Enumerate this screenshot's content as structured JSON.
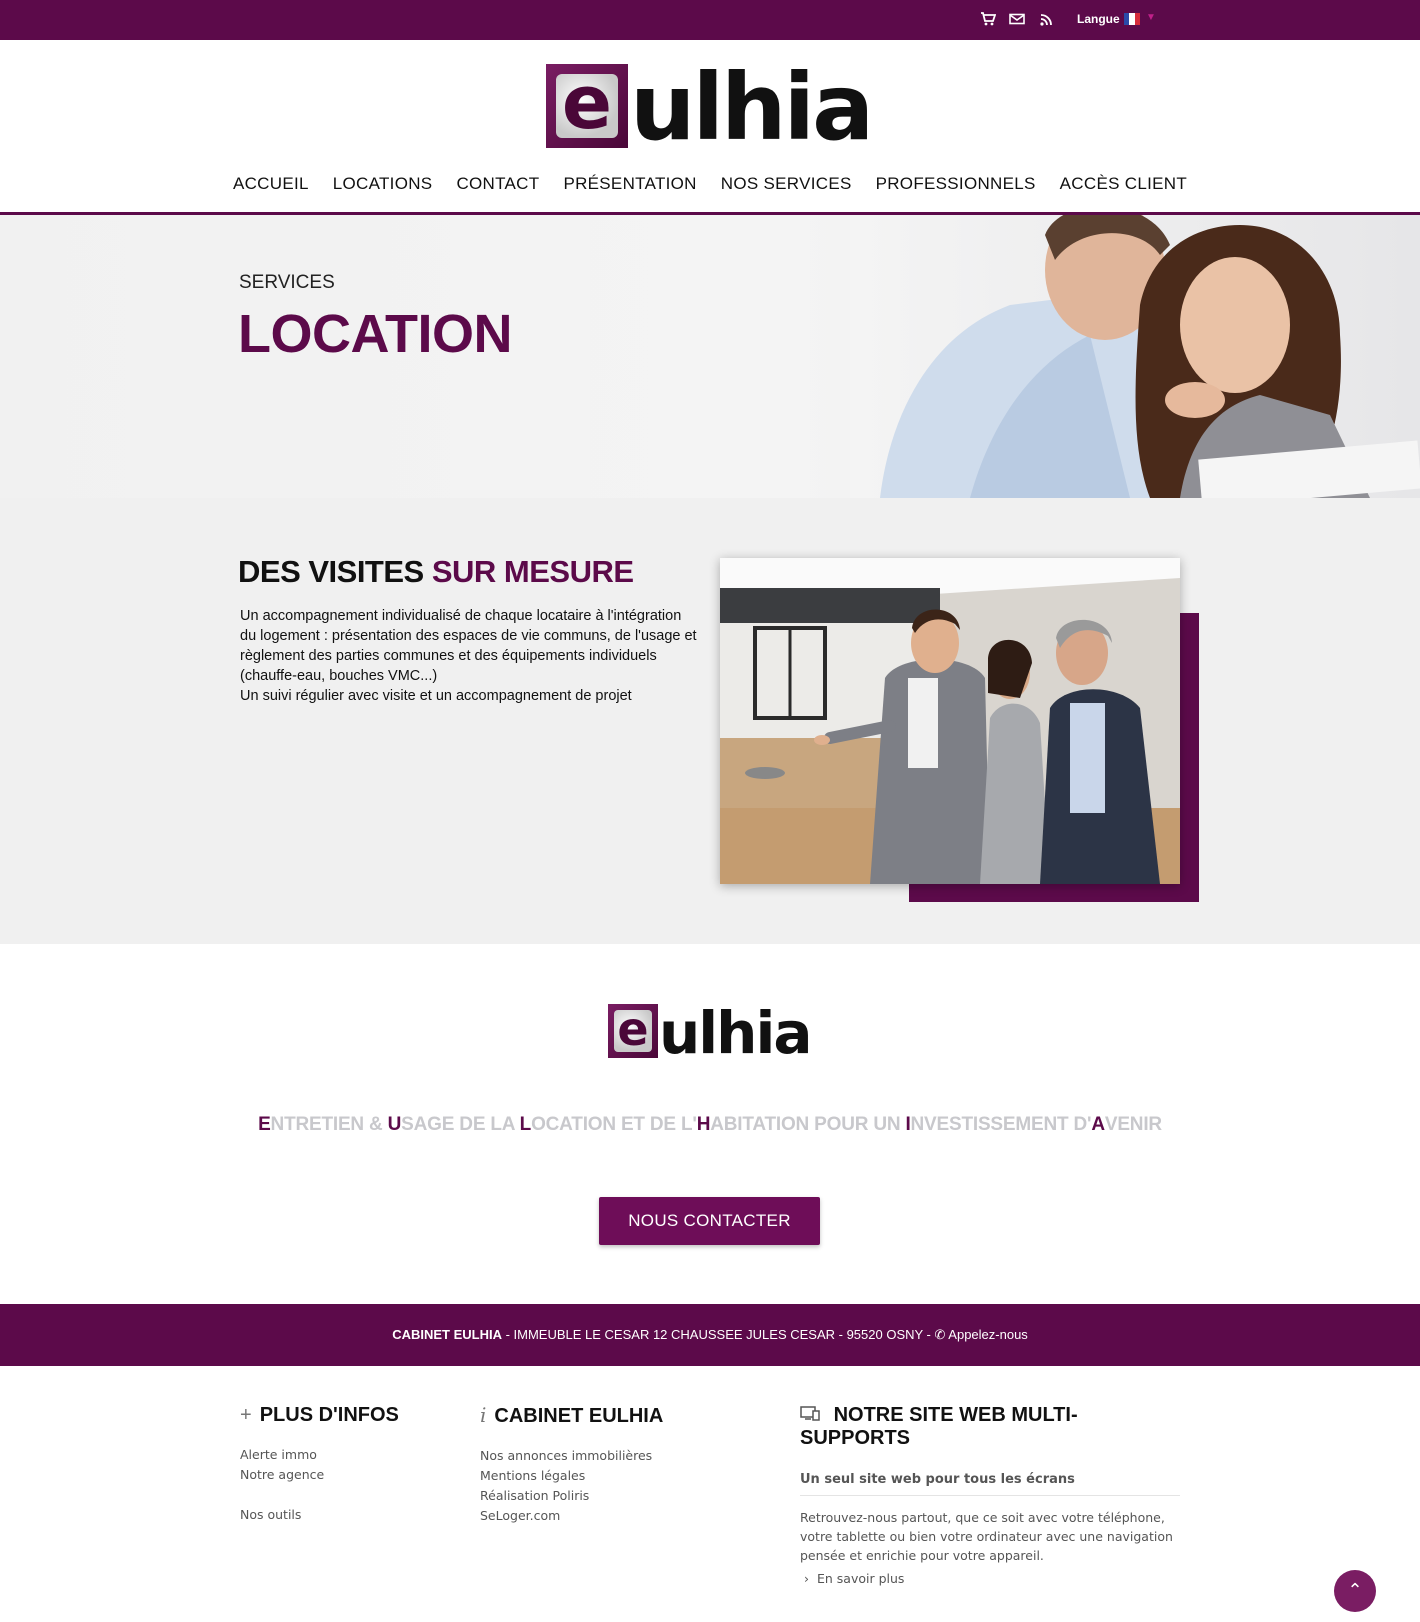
{
  "topbar": {
    "lang_label": "Langue",
    "icons": [
      "cart-icon",
      "mail-icon",
      "rss-icon"
    ]
  },
  "logo": {
    "mark": "e",
    "rest": "ulhia"
  },
  "nav": [
    "ACCUEIL",
    "LOCATIONS",
    "CONTACT",
    "PRÉSENTATION",
    "NOS SERVICES",
    "PROFESSIONNELS",
    "ACCÈS CLIENT"
  ],
  "hero": {
    "subtitle": "SERVICES",
    "title": "LOCATION"
  },
  "section": {
    "heading_dark": "DES VISITES",
    "heading_accent": "SUR MESURE",
    "paragraph1": "Un accompagnement individualisé de chaque locataire à l'intégration du logement : présentation des espaces de vie communs, de l'usage et règlement des parties communes et des équipements individuels (chauffe-eau, bouches VMC...)",
    "paragraph2": "Un suivi régulier avec visite et un accompagnement de projet"
  },
  "tagline": [
    {
      "cap": "E",
      "rest": "NTRETIEN & "
    },
    {
      "cap": "U",
      "rest": "SAGE DE LA "
    },
    {
      "cap": "L",
      "rest": "OCATION ET DE L'"
    },
    {
      "cap": "H",
      "rest": "ABITATION POUR UN "
    },
    {
      "cap": "I",
      "rest": "NVESTISSEMENT D'"
    },
    {
      "cap": "A",
      "rest": "VENIR"
    }
  ],
  "cta_label": "NOUS CONTACTER",
  "address": {
    "name": "CABINET EULHIA",
    "text": " - IMMEUBLE LE CESAR 12 CHAUSSEE JULES CESAR - 95520 OSNY - ",
    "call": "Appelez-nous"
  },
  "footer": {
    "col1": {
      "title": "PLUS D'INFOS",
      "links": [
        "Alerte immo",
        "Notre agence",
        "",
        "Nos outils"
      ]
    },
    "col2": {
      "title": "CABINET EULHIA",
      "links": [
        "Nos annonces immobilières",
        "Mentions légales",
        "Réalisation Poliris",
        "SeLoger.com"
      ]
    },
    "col3": {
      "title": "NOTRE SITE WEB MULTI-SUPPORTS",
      "lead": "Un seul site web pour tous les écrans",
      "text": "Retrouvez-nous partout, que ce soit avec votre téléphone, votre tablette ou bien votre ordinateur avec une navigation pensée et enrichie pour votre appareil.",
      "more": "En savoir plus"
    }
  },
  "colors": {
    "brand": "#5c0a4a",
    "cta": "#6e0d58",
    "tagline_grey": "#c8c8cc"
  }
}
